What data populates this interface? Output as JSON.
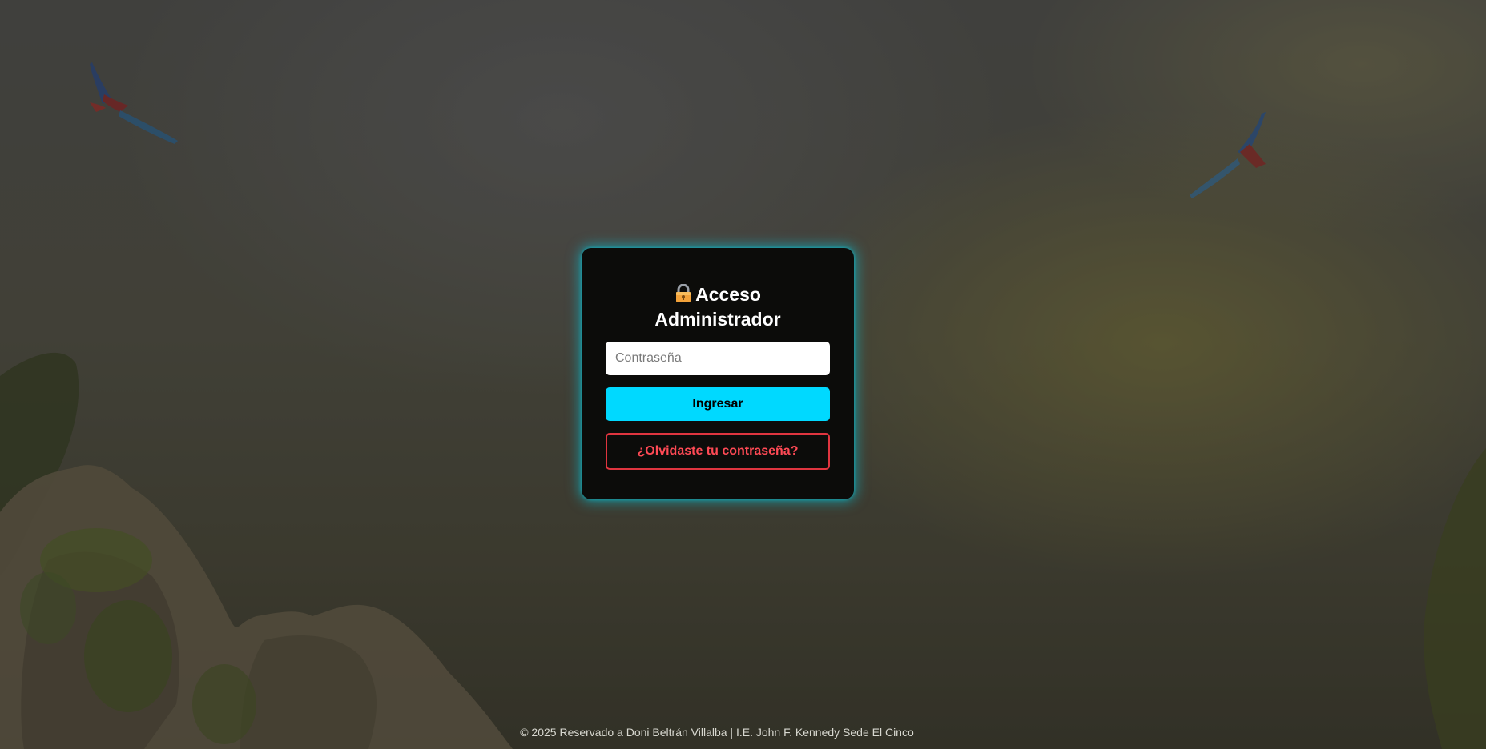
{
  "login": {
    "title_line1": "Acceso",
    "title_line2": "Administrador",
    "password_placeholder": "Contraseña",
    "submit_label": "Ingresar",
    "forgot_label": "¿Olvidaste tu contraseña?"
  },
  "footer": {
    "text": "© 2025 Reservado a Doni Beltrán Villalba | I.E. John F. Kennedy Sede El Cinco"
  },
  "icons": {
    "title_icon": "lock-icon"
  },
  "colors": {
    "accent": "#00d9ff",
    "danger": "#e0353f",
    "card_bg": "#0c0c0a"
  }
}
